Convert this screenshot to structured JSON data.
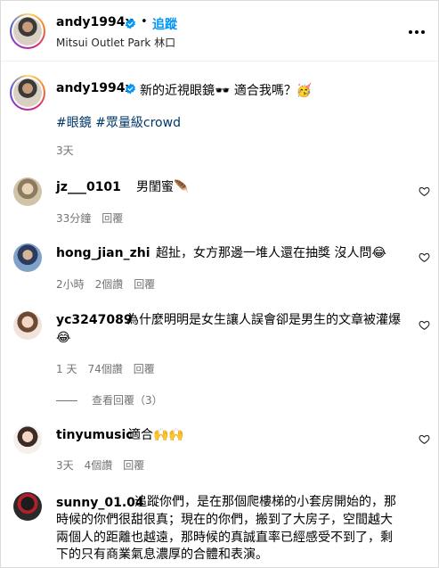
{
  "header": {
    "username": "andy1994x",
    "separator": "•",
    "follow_label": "追蹤",
    "location": "Mitsui Outlet Park 林口",
    "more_icon": "more-horizontal-icon"
  },
  "caption": {
    "username": "andy1994x",
    "text": "新的近視眼鏡🕶️ 適合我嗎？🥳",
    "hashtags": "#眼鏡 #眾量級crowd",
    "time": "3天"
  },
  "comments": [
    {
      "username": "jz___0101",
      "text": "男閨蜜🪶",
      "time": "33分鐘",
      "likes": "",
      "reply_label": "回覆"
    },
    {
      "username": "hong_jian_zhi",
      "text": "超扯，女方那邊一堆人還在抽獎 沒人問😂",
      "time": "2小時",
      "likes": "2個讚",
      "reply_label": "回覆"
    },
    {
      "username": "yc3247089",
      "text_line1": "為什麼明明是女生讓人誤會卻是男生的文章被灌爆",
      "text_line2": "😂",
      "time": "1 天",
      "likes": "74個讚",
      "reply_label": "回覆",
      "view_replies": "查看回覆（3）"
    },
    {
      "username": "tinyumusic",
      "text": "適合🙌🙌",
      "time": "3天",
      "likes": "4個讚",
      "reply_label": "回覆"
    },
    {
      "username": "sunny_01.04",
      "text_line1": "追蹤你們，是在那個爬樓梯的小套房開始的，那",
      "text_line2": "時候的你們很甜很真；現在的你們，搬到了大房子，空間越大",
      "text_line3": "兩個人的距離也越遠，那時候的真誠直率已經感受不到了，剩",
      "text_line4": "下的只有商業氣息濃厚的合體和表演。"
    }
  ],
  "colors": {
    "link": "#0095f6",
    "hashtag": "#00376b",
    "muted": "#737373",
    "verified": "#0095f6"
  }
}
